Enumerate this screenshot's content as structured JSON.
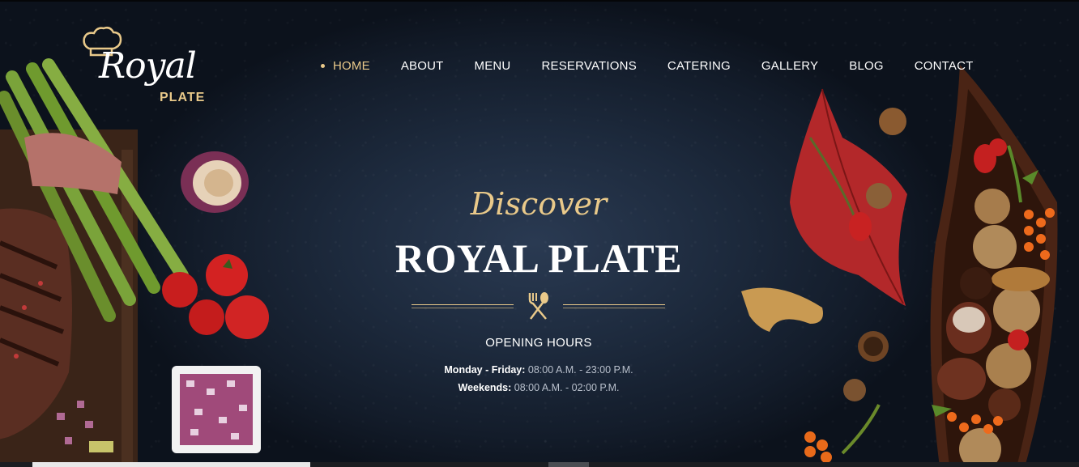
{
  "logo": {
    "top_word": "Royal",
    "bottom_word": "PLATE",
    "icon": "chef-hat-icon"
  },
  "nav": {
    "items": [
      {
        "label": "HOME",
        "active": true
      },
      {
        "label": "ABOUT",
        "active": false
      },
      {
        "label": "MENU",
        "active": false
      },
      {
        "label": "RESERVATIONS",
        "active": false
      },
      {
        "label": "CATERING",
        "active": false
      },
      {
        "label": "GALLERY",
        "active": false
      },
      {
        "label": "BLOG",
        "active": false
      },
      {
        "label": "CONTACT",
        "active": false
      }
    ]
  },
  "hero": {
    "script_heading": "Discover",
    "title": "ROYAL PLATE",
    "divider_icon": "fork-spoon-icon",
    "hours_title": "OPENING HOURS",
    "hours": [
      {
        "label": "Monday - Friday:",
        "time": "08:00 A.M. - 23:00 P.M."
      },
      {
        "label": "Weekends:",
        "time": "08:00 A.M. - 02:00 P.M."
      }
    ]
  },
  "colors": {
    "accent": "#e9c98a",
    "text": "#ffffff",
    "muted_text": "#b9c0cc",
    "background": "#1d2a3d"
  }
}
